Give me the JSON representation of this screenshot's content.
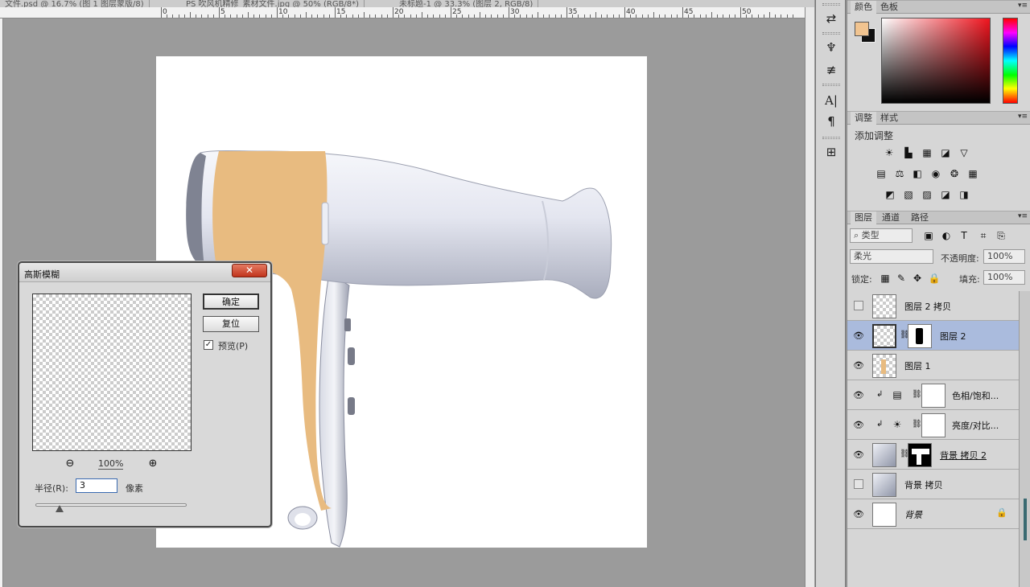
{
  "document_tabs": [
    "文件.psd @ 16.7% (图 1 图层蒙版/8)",
    "PS 吹风机精修_素材文件.jpg @ 50% (RGB/8*)",
    "未标题-1 @ 33.3% (图层 2, RGB/8)"
  ],
  "ruler": {
    "labels": [
      "0",
      "5",
      "10",
      "15",
      "20",
      "25",
      "30",
      "35",
      "40",
      "45",
      "50"
    ]
  },
  "color_panel": {
    "tabs": [
      "颜色",
      "色板"
    ],
    "foreground": "#f1c490",
    "background": "#111111"
  },
  "adjustments_panel": {
    "tabs": [
      "调整",
      "样式"
    ],
    "title": "添加调整"
  },
  "layers_panel": {
    "tabs": [
      "图层",
      "通道",
      "路径"
    ],
    "filter_kind": "类型",
    "blend_mode": "柔光",
    "opacity_label": "不透明度:",
    "opacity_value": "100%",
    "lock_label": "锁定:",
    "fill_label": "填充:",
    "fill_value": "100%",
    "layers": [
      {
        "name": "图层 2 拷贝",
        "visible": false
      },
      {
        "name": "图层 2",
        "visible": true,
        "selected": true
      },
      {
        "name": "图层 1",
        "visible": true
      },
      {
        "name": "色相/饱和...",
        "visible": true
      },
      {
        "name": "亮度/对比...",
        "visible": true
      },
      {
        "name": "背景 拷贝 2",
        "visible": true
      },
      {
        "name": "背景 拷贝",
        "visible": false
      },
      {
        "name": "背景",
        "visible": true,
        "locked": true
      }
    ]
  },
  "dialog": {
    "title": "高斯模糊",
    "ok_label": "确定",
    "reset_label": "复位",
    "preview_label": "预览(P)",
    "zoom_value": "100%",
    "radius_label": "半径(R):",
    "radius_value": "3",
    "radius_unit": "像素"
  },
  "tools": {
    "text_icon": "A|",
    "paragraph_icon": "¶"
  },
  "colors": {
    "accent_selected": "#aabbdd",
    "skin_fill": "#e8bb80"
  }
}
